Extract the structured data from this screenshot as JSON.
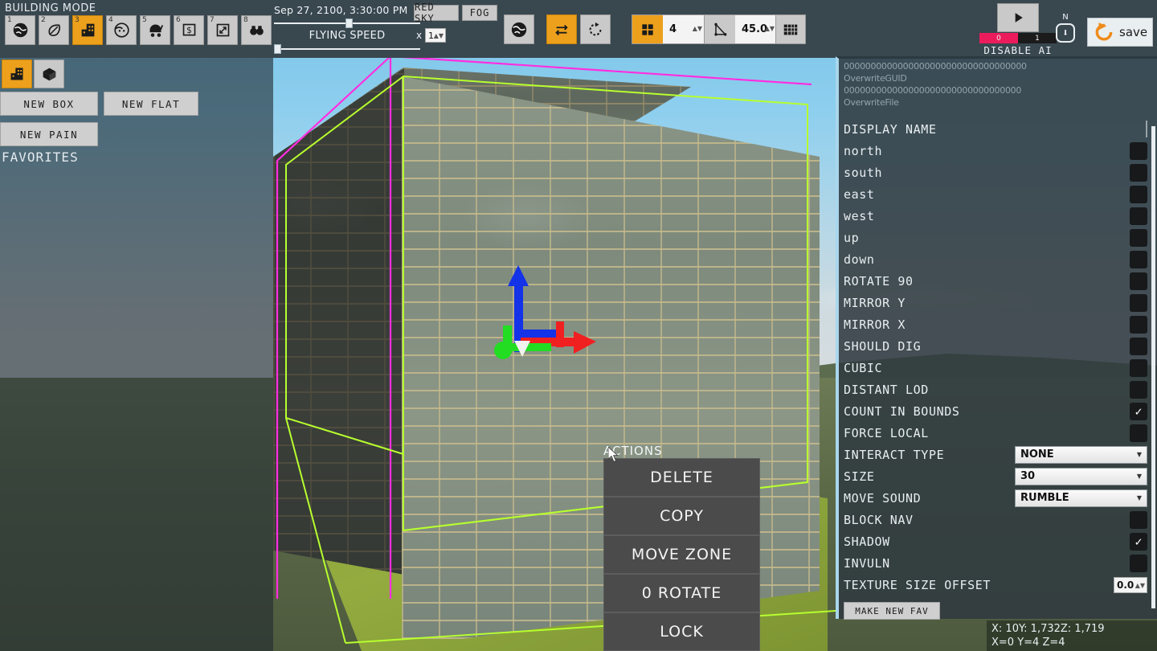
{
  "app": {
    "mode_title": "BUILDING MODE"
  },
  "toolbar": {
    "modes": [
      {
        "num": "1",
        "icon": "globe-icon",
        "active": false
      },
      {
        "num": "2",
        "icon": "leaf-icon",
        "active": false
      },
      {
        "num": "3",
        "icon": "building-icon",
        "active": true
      },
      {
        "num": "4",
        "icon": "face-icon",
        "active": false
      },
      {
        "num": "5",
        "icon": "stroller-icon",
        "active": false
      },
      {
        "num": "6",
        "icon": "money-icon",
        "active": false
      },
      {
        "num": "7",
        "icon": "resize-icon",
        "active": false
      },
      {
        "num": "8",
        "icon": "binoculars-icon",
        "active": false
      }
    ],
    "datetime": "Sep 27, 2100, 3:30:00 PM",
    "flying_speed_label": "FLYING SPEED",
    "speed_multiplier_prefix": "x",
    "speed_multiplier": "1",
    "red_sky": "RED SKY",
    "fog": "FOG",
    "globe_button": "globe-icon",
    "translate_button": "translate-arrows-icon",
    "rotate_button": "rotate-icon",
    "grid_snap_value": "4",
    "angle_snap_value": "45.0",
    "grid_button": "grid-icon",
    "ai": {
      "play": "play-icon",
      "seg_on": "0",
      "seg_off": "1",
      "label": "DISABLE AI"
    },
    "compass": {
      "north": "N",
      "icon": "down-arrow-icon"
    },
    "save": {
      "label": "save",
      "icon": "refresh-icon"
    }
  },
  "sidebar": {
    "tabs": [
      {
        "icon": "building-icon",
        "active": true
      },
      {
        "icon": "cube-icon",
        "active": false
      }
    ],
    "new_box": "NEW BOX",
    "new_flat": "NEW FLAT",
    "new_pain": "NEW PAIN",
    "favorites": "FAVORITES"
  },
  "properties": {
    "guid_zeros_1": "0000000000000000000000000000000000",
    "overwrite_guid": "OverwriteGUID",
    "guid_zeros_2": "000000000000000000000000000000000",
    "overwrite_file": "OverwriteFile",
    "rows": [
      {
        "label": "DISPLAY NAME",
        "type": "text",
        "value": ""
      },
      {
        "label": "north",
        "type": "checkbox",
        "checked": false
      },
      {
        "label": "south",
        "type": "checkbox",
        "checked": false
      },
      {
        "label": "east",
        "type": "checkbox",
        "checked": false
      },
      {
        "label": "west",
        "type": "checkbox",
        "checked": false
      },
      {
        "label": "up",
        "type": "checkbox",
        "checked": false
      },
      {
        "label": "down",
        "type": "checkbox",
        "checked": false
      },
      {
        "label": "ROTATE 90",
        "type": "checkbox",
        "checked": false
      },
      {
        "label": "MIRROR Y",
        "type": "checkbox",
        "checked": false
      },
      {
        "label": "MIRROR X",
        "type": "checkbox",
        "checked": false
      },
      {
        "label": "SHOULD DIG",
        "type": "checkbox",
        "checked": false
      },
      {
        "label": "CUBIC",
        "type": "checkbox",
        "checked": false
      },
      {
        "label": "DISTANT LOD",
        "type": "checkbox",
        "checked": false
      },
      {
        "label": "COUNT IN BOUNDS",
        "type": "checkbox",
        "checked": true
      },
      {
        "label": "FORCE LOCAL",
        "type": "checkbox",
        "checked": false
      },
      {
        "label": "INTERACT TYPE",
        "type": "dropdown",
        "value": "NONE"
      },
      {
        "label": "SIZE",
        "type": "dropdown",
        "value": "30"
      },
      {
        "label": "MOVE SOUND",
        "type": "dropdown",
        "value": "RUMBLE"
      },
      {
        "label": "BLOCK NAV",
        "type": "checkbox",
        "checked": false
      },
      {
        "label": "SHADOW",
        "type": "checkbox",
        "checked": true
      },
      {
        "label": "INVULN",
        "type": "checkbox",
        "checked": false
      },
      {
        "label": "TEXTURE SIZE OFFSET",
        "type": "number",
        "value": "0.0"
      }
    ],
    "make_new_fav": "MAKE NEW FAV"
  },
  "context_menu": {
    "title": "ACTIONS",
    "items": [
      "DELETE",
      "COPY",
      "MOVE ZONE",
      "0 ROTATE",
      "LOCK"
    ]
  },
  "status": {
    "world_coords": "X: 10Y: 1,732Z: 1,719",
    "grid_coords": "X=0 Y=4 Z=4"
  },
  "colors": {
    "accent": "#eda01c",
    "panel": "#39474f",
    "selection_outline": "#b7ff2e",
    "zone_bounds": "#ff2ee0",
    "ai_on": "#ec1c5c",
    "panel_border": "#a9d6ec"
  }
}
